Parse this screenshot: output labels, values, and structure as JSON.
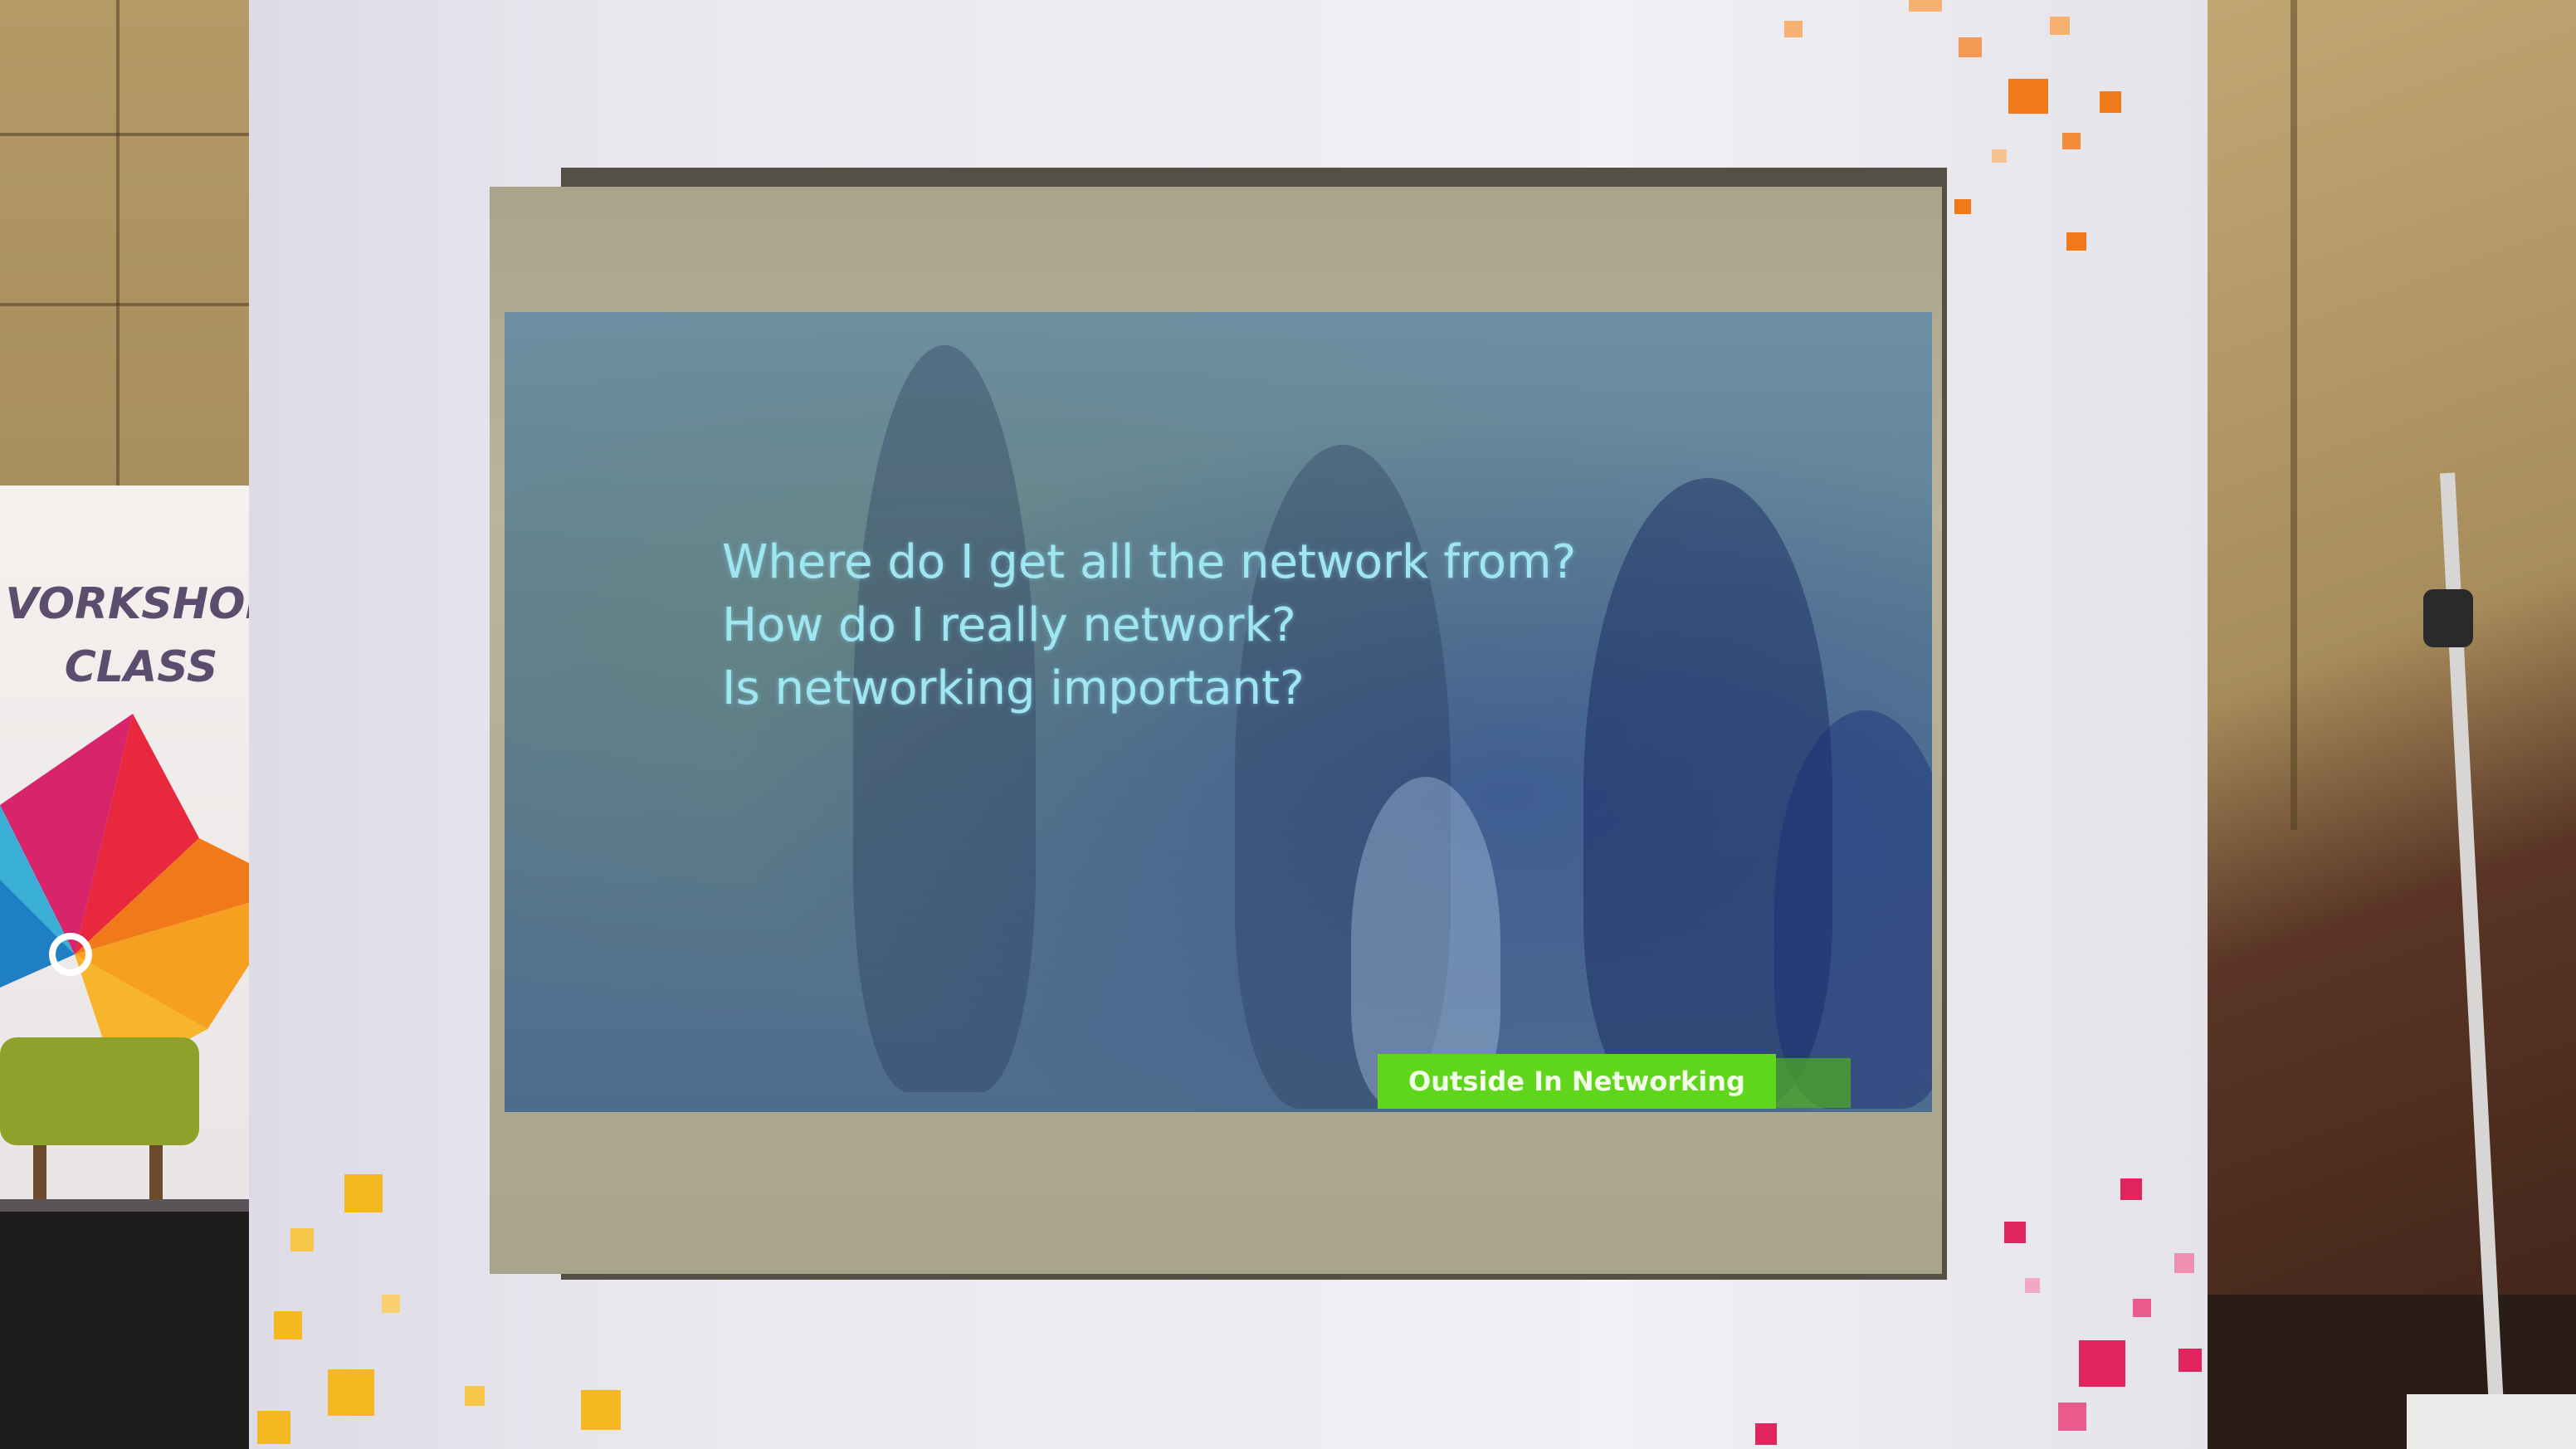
{
  "banner": {
    "title_line1": "VORKSHOP",
    "title_line2": "CLASS"
  },
  "slide": {
    "questions": [
      "Where do I get all the network from?",
      "How do I really network?",
      "Is networking important?"
    ],
    "tag_label": "Outside In Networking",
    "text_color": "#9fe6f0",
    "tag_color": "#5fd61c"
  }
}
